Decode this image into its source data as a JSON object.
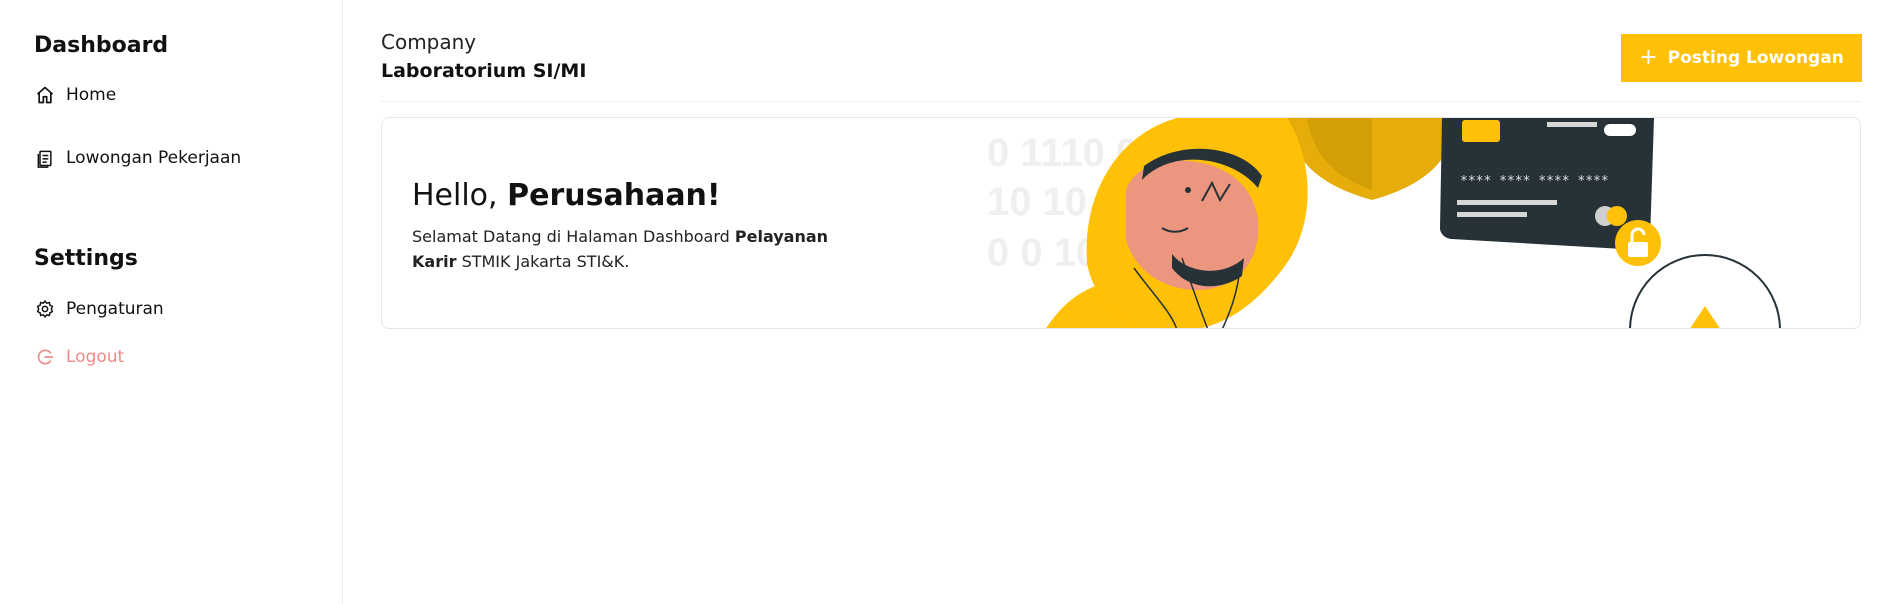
{
  "sidebar": {
    "dashboard_title": "Dashboard",
    "home_label": "Home",
    "jobs_label": "Lowongan Pekerjaan",
    "settings_title": "Settings",
    "settings_label": "Pengaturan",
    "logout_label": "Logout"
  },
  "header": {
    "subtitle": "Company",
    "company_name": "Laboratorium SI/MI",
    "post_button_label": "Posting Lowongan"
  },
  "welcome": {
    "greeting": "Hello,",
    "greeting_name": "Perusahaan!",
    "text_part1": "Selamat Datang di Halaman Dashboard",
    "text_bold": "Pelayanan Karir",
    "text_part2": "STMIK Jakarta STI&K.",
    "binary_row1": "0 1110 0",
    "binary_row2": "10 10 0",
    "binary_row3": "0 0 10 0",
    "card_mask": "**** **** **** ****"
  },
  "colors": {
    "accent": "#FFC107",
    "logout": "#f08a8a",
    "card_dark": "#263238"
  }
}
